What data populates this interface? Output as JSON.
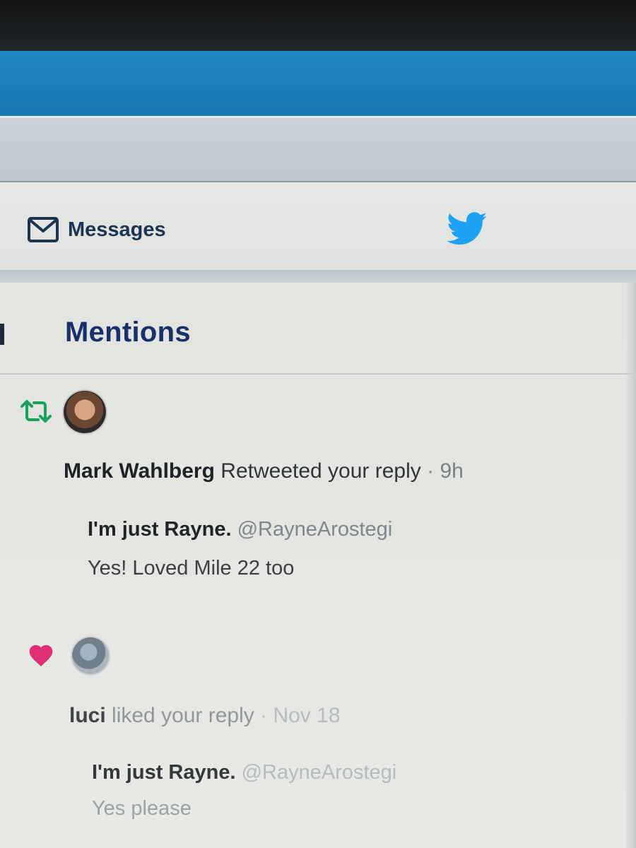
{
  "nav": {
    "messages_label": "Messages",
    "messages_icon": "envelope-icon",
    "logo_icon": "twitter-bird-icon",
    "accent_color": "#1da1f2"
  },
  "mentions": {
    "title": "Mentions"
  },
  "notifications": [
    {
      "type_icon": "retweet-icon",
      "icon_color": "#17bf63",
      "user": "Mark Wahlberg",
      "action": "Retweeted your reply",
      "separator": "·",
      "time": "9h",
      "quoted": {
        "name": "I'm just Rayne.",
        "handle": "@RayneArostegi",
        "text": "Yes! Loved Mile 22 too"
      }
    },
    {
      "type_icon": "heart-icon",
      "icon_color": "#e0245e",
      "user": "luci",
      "action": "liked your reply",
      "separator": "·",
      "time": "Nov 18",
      "quoted": {
        "name": "I'm just Rayne.",
        "handle": "@RayneArostegi",
        "text": "Yes please"
      }
    }
  ]
}
